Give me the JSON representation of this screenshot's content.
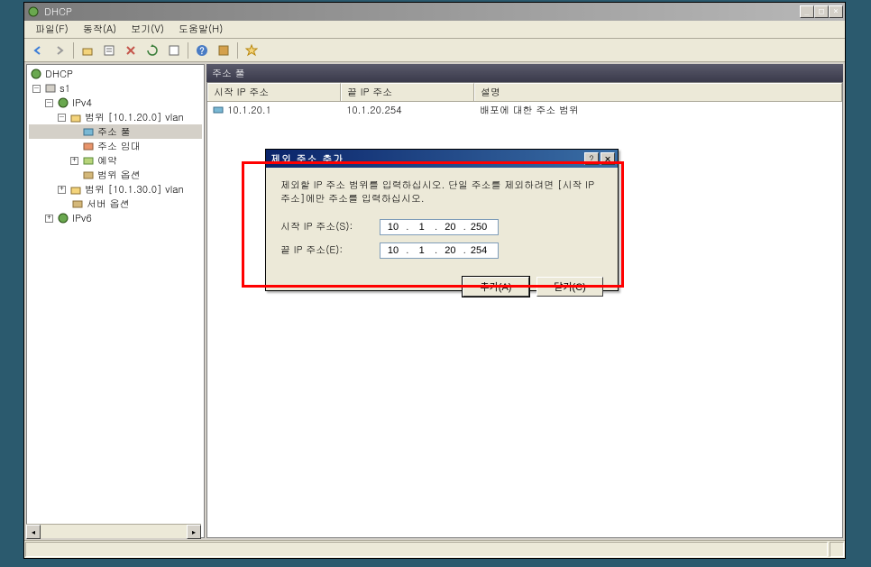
{
  "window": {
    "title": "DHCP"
  },
  "menubar": {
    "file": "파일(F)",
    "action": "동작(A)",
    "view": "보기(V)",
    "help": "도움말(H)"
  },
  "tree": {
    "root": "DHCP",
    "server": "s1",
    "ipv4": "IPv4",
    "scope1": "범위 [10.1.20.0] vlan",
    "pool": "주소 풀",
    "lease": "주소 임대",
    "reservation": "예약",
    "options": "범위 옵션",
    "scope2": "범위 [10.1.30.0] vlan",
    "server_options": "서버 옵션",
    "ipv6": "IPv6"
  },
  "list": {
    "header": "주소 풀",
    "col1": "시작 IP 주소",
    "col2": "끝 IP 주소",
    "col3": "설명",
    "row1": {
      "start": "10.1.20.1",
      "end": "10.1.20.254",
      "desc": "배포에 대한 주소 범위"
    }
  },
  "dialog": {
    "title": "제외 주소 추가",
    "instruction": "제외할 IP 주소 범위를 입력하십시오. 단일 주소를 제외하려면 [시작 IP 주소]에만 주소를 입력하십시오.",
    "start_label": "시작 IP 주소(S):",
    "end_label": "끝 IP 주소(E):",
    "start_ip": {
      "o1": "10",
      "o2": "1",
      "o3": "20",
      "o4": "250"
    },
    "end_ip": {
      "o1": "10",
      "o2": "1",
      "o3": "20",
      "o4": "254"
    },
    "add_btn": "추가(A)",
    "close_btn": "닫기(C)"
  }
}
